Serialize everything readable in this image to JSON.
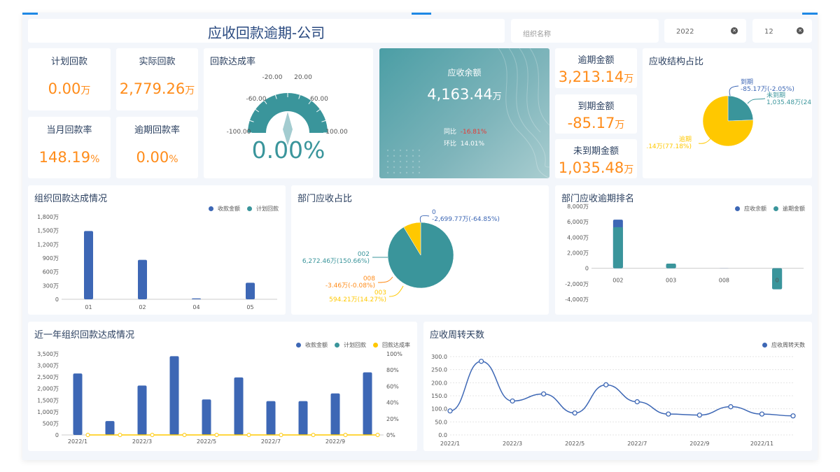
{
  "header": {
    "title": "应收回款逾期-公司",
    "org_placeholder": "组织名称",
    "year": "2022",
    "month": "12"
  },
  "kpis": {
    "plan": {
      "label": "计划回款",
      "value": "0.00",
      "unit": "万"
    },
    "actual": {
      "label": "实际回款",
      "value": "2,779.26",
      "unit": "万"
    },
    "month_rate": {
      "label": "当月回款率",
      "value": "148.19",
      "unit": "%"
    },
    "overdue_rate": {
      "label": "逾期回款率",
      "value": "0.00",
      "unit": "%"
    }
  },
  "gauge": {
    "title": "回款达成率",
    "value": 0,
    "value_label": "0.00%",
    "ticks": [
      "-100.00",
      "-60.00",
      "-20.00",
      "20.00",
      "60.00",
      "100.00"
    ]
  },
  "receivable": {
    "label": "应收余额",
    "value": "4,163.44",
    "unit": "万",
    "yoy_label": "同比",
    "yoy": "-16.81%",
    "mom_label": "环比",
    "mom": "14.01%"
  },
  "amounts": {
    "overdue": {
      "label": "逾期金额",
      "value": "3,213.14",
      "unit": "万"
    },
    "due": {
      "label": "到期金额",
      "value": "-85.17",
      "unit": "万"
    },
    "not_due": {
      "label": "未到期金额",
      "value": "1,035.48",
      "unit": "万"
    }
  },
  "colors": {
    "blue": "#3d67b5",
    "teal": "#3a959b",
    "yellow": "#ffc800",
    "orange": "#ff8c1a",
    "red": "#e53935"
  },
  "chart_data": [
    {
      "id": "structure",
      "type": "pie",
      "title": "应收结构占比",
      "slices": [
        {
          "name": "到期",
          "value": -85.17,
          "label": "-85.17万(-2.05%)",
          "color": "#3d67b5"
        },
        {
          "name": "未到期",
          "value": 1035.48,
          "label": "1,035.48万(24",
          "color": "#3a959b"
        },
        {
          "name": "逾期",
          "value": 3213.14,
          "label": ".14万(77.18%)",
          "color": "#ffc800"
        }
      ]
    },
    {
      "id": "org",
      "type": "bar",
      "title": "组织回款达成情况",
      "categories": [
        "01",
        "02",
        "04",
        "05"
      ],
      "series": [
        {
          "name": "收款金额",
          "values": [
            1490,
            860,
            20,
            360
          ],
          "color": "#3d67b5"
        },
        {
          "name": "计划回款",
          "values": [
            0,
            0,
            0,
            0
          ],
          "color": "#3a959b"
        }
      ],
      "ylim": [
        0,
        1800
      ],
      "yticks": [
        "0",
        "300万",
        "600万",
        "900万",
        "1,200万",
        "1,500万",
        "1,800万"
      ]
    },
    {
      "id": "dept_pie",
      "type": "pie",
      "title": "部门应收占比",
      "slices": [
        {
          "name": "0",
          "value": -2699.77,
          "label": "-2,699.77万(-64.85%)",
          "color": "#3d67b5"
        },
        {
          "name": "002",
          "value": 6272.46,
          "label": "6,272.46万(150.66%)",
          "color": "#3a959b"
        },
        {
          "name": "008",
          "value": -3.46,
          "label": "-3.46万(-0.08%)",
          "color": "#ff8c1a"
        },
        {
          "name": "003",
          "value": 594.21,
          "label": "594.21万(14.27%)",
          "color": "#ffc800"
        }
      ]
    },
    {
      "id": "dept_rank",
      "type": "bar",
      "title": "部门应收逾期排名",
      "categories": [
        "002",
        "003",
        "008",
        "0"
      ],
      "series": [
        {
          "name": "应收余额",
          "values": [
            6272.46,
            594.21,
            -3.46,
            -2699.77
          ],
          "color": "#3d67b5"
        },
        {
          "name": "逾期金额",
          "values": [
            5300,
            600,
            0,
            -2700
          ],
          "color": "#3a959b"
        }
      ],
      "ylim": [
        -4000,
        8000
      ],
      "yticks": [
        "-4,000万",
        "-2,000万",
        "0",
        "2,000万",
        "4,000万",
        "6,000万",
        "8,000万"
      ]
    },
    {
      "id": "year",
      "type": "bar",
      "title": "近一年组织回款达成情况",
      "categories": [
        "2022/1",
        "2022/2",
        "2022/3",
        "2022/4",
        "2022/5",
        "2022/6",
        "2022/7",
        "2022/8",
        "2022/9",
        "2022/10"
      ],
      "xlabels": [
        "2022/1",
        "2022/3",
        "2022/5",
        "2022/7",
        "2022/9"
      ],
      "series": [
        {
          "name": "收款金额",
          "values": [
            2650,
            600,
            2130,
            3400,
            1530,
            2480,
            1460,
            1460,
            1790,
            2700
          ],
          "color": "#3d67b5"
        },
        {
          "name": "计划回款",
          "values": [
            0,
            0,
            0,
            0,
            0,
            0,
            0,
            0,
            0,
            0
          ],
          "color": "#3a959b"
        },
        {
          "name": "回款达成率",
          "values": [
            0,
            0,
            0,
            0,
            0,
            0,
            0,
            0,
            0,
            0
          ],
          "color": "#ffc800",
          "type": "line"
        }
      ],
      "ylim": [
        0,
        3500
      ],
      "yticks": [
        "0",
        "500万",
        "1,000万",
        "1,500万",
        "2,000万",
        "2,500万",
        "3,000万",
        "3,500万"
      ],
      "y2lim": [
        0,
        100
      ],
      "y2ticks": [
        "0%",
        "20%",
        "40%",
        "60%",
        "80%",
        "100%"
      ]
    },
    {
      "id": "turnover",
      "type": "line",
      "title": "应收周转天数",
      "categories": [
        "2022/1",
        "2022/2",
        "2022/3",
        "2022/4",
        "2022/5",
        "2022/6",
        "2022/7",
        "2022/8",
        "2022/9",
        "2022/10",
        "2022/11",
        "2022/12"
      ],
      "xlabels": [
        "2022/1",
        "2022/3",
        "2022/5",
        "2022/7",
        "2022/9",
        "2022/11"
      ],
      "series": [
        {
          "name": "应收周转天数",
          "values": [
            92,
            282,
            130,
            157,
            84,
            192,
            127,
            80,
            76,
            108,
            80,
            73
          ],
          "color": "#3d67b5"
        }
      ],
      "ylim": [
        0,
        300
      ],
      "yticks": [
        "0.0",
        "50.0",
        "100.0",
        "150.0",
        "200.0",
        "250.0",
        "300.0"
      ]
    }
  ]
}
